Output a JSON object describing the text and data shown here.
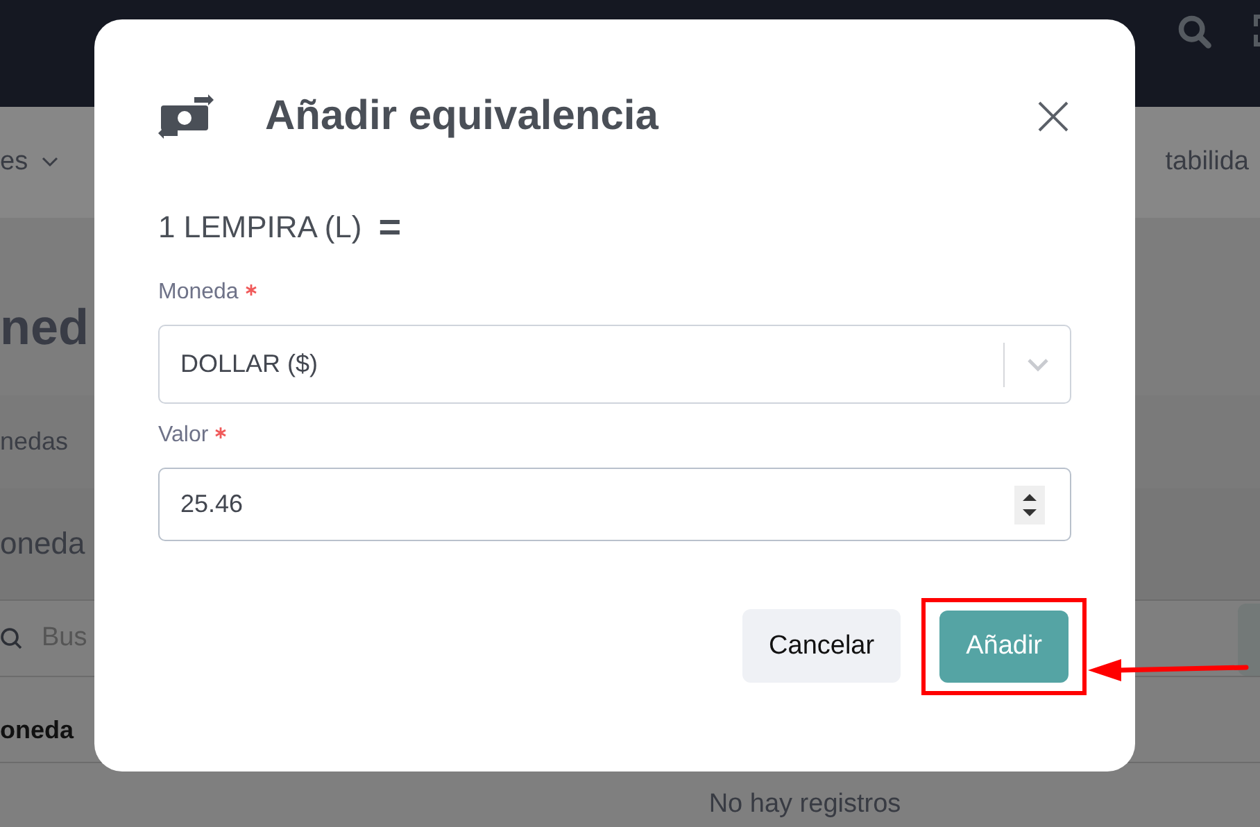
{
  "nav": {
    "left_item": "es",
    "right_item": "tabilida"
  },
  "page": {
    "heading": "ned",
    "breadcrumb": "nedas",
    "section_title": "oneda",
    "search_placeholder": "Bus",
    "column_1": "oneda",
    "empty_message": "No hay registros"
  },
  "dialog": {
    "title": "Añadir equivalencia",
    "base_amount": "1 LEMPIRA (L)",
    "equals": "=",
    "fields": [
      {
        "kind": "select",
        "label": "Moneda",
        "required": true,
        "value": "DOLLAR ($)"
      },
      {
        "kind": "number",
        "label": "Valor",
        "required": true,
        "value": "25.46"
      }
    ],
    "buttons": [
      {
        "label": "Cancelar",
        "kind": "secondary",
        "highlighted": false
      },
      {
        "label": "Añadir",
        "kind": "primary",
        "highlighted": true
      }
    ]
  }
}
